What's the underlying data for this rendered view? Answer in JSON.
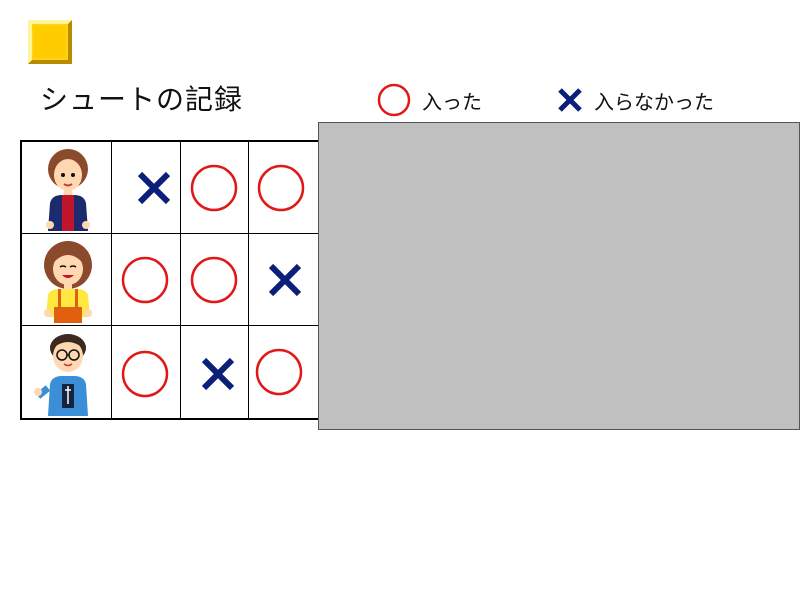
{
  "title": "シュートの記録",
  "legend": {
    "made_label": "入った",
    "missed_label": "入らなかった"
  },
  "colors": {
    "made_circle": "#e01818",
    "missed_cross": "#0b1f7a",
    "yellow_button": "#ffcc00",
    "gray_panel": "#c0c0c0"
  },
  "players": [
    {
      "avatar": "boy-avatar-icon",
      "shots": [
        "miss",
        "made",
        "made"
      ]
    },
    {
      "avatar": "girl-avatar-icon",
      "shots": [
        "made",
        "made",
        "miss"
      ]
    },
    {
      "avatar": "man-glasses-avatar-icon",
      "shots": [
        "made",
        "miss",
        "made"
      ]
    }
  ]
}
